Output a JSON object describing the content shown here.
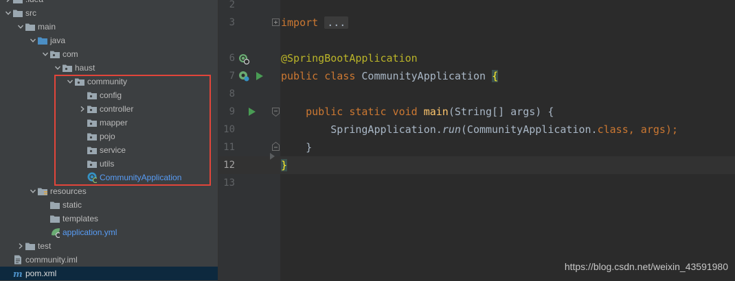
{
  "tree": {
    "items": [
      {
        "label": ".idea",
        "depth": 0,
        "expanded": false,
        "icon": "folder-icon",
        "color": "normal"
      },
      {
        "label": "src",
        "depth": 0,
        "expanded": true,
        "icon": "folder-icon",
        "color": "normal"
      },
      {
        "label": "main",
        "depth": 1,
        "expanded": true,
        "icon": "folder-icon",
        "color": "normal"
      },
      {
        "label": "java",
        "depth": 2,
        "expanded": true,
        "icon": "source-folder-icon",
        "color": "normal"
      },
      {
        "label": "com",
        "depth": 3,
        "expanded": true,
        "icon": "package-icon",
        "color": "normal"
      },
      {
        "label": "haust",
        "depth": 4,
        "expanded": true,
        "icon": "package-icon",
        "color": "normal"
      },
      {
        "label": "community",
        "depth": 5,
        "expanded": true,
        "icon": "package-icon",
        "color": "normal"
      },
      {
        "label": "config",
        "depth": 6,
        "expanded": null,
        "icon": "package-icon",
        "color": "normal"
      },
      {
        "label": "controller",
        "depth": 6,
        "expanded": false,
        "icon": "package-icon",
        "color": "normal"
      },
      {
        "label": "mapper",
        "depth": 6,
        "expanded": null,
        "icon": "package-icon",
        "color": "normal"
      },
      {
        "label": "pojo",
        "depth": 6,
        "expanded": null,
        "icon": "package-icon",
        "color": "normal"
      },
      {
        "label": "service",
        "depth": 6,
        "expanded": null,
        "icon": "package-icon",
        "color": "normal"
      },
      {
        "label": "utils",
        "depth": 6,
        "expanded": null,
        "icon": "package-icon",
        "color": "normal"
      },
      {
        "label": "CommunityApplication",
        "depth": 6,
        "expanded": null,
        "icon": "spring-class-icon",
        "color": "blue"
      },
      {
        "label": "resources",
        "depth": 2,
        "expanded": true,
        "icon": "resources-folder-icon",
        "color": "normal"
      },
      {
        "label": "static",
        "depth": 3,
        "expanded": null,
        "icon": "folder-icon",
        "color": "normal"
      },
      {
        "label": "templates",
        "depth": 3,
        "expanded": null,
        "icon": "folder-icon",
        "color": "normal"
      },
      {
        "label": "application.yml",
        "depth": 3,
        "expanded": null,
        "icon": "spring-yml-icon",
        "color": "blue"
      },
      {
        "label": "test",
        "depth": 1,
        "expanded": false,
        "icon": "folder-icon",
        "color": "normal"
      },
      {
        "label": "community.iml",
        "depth": 0,
        "expanded": null,
        "icon": "iml-file-icon",
        "color": "normal"
      },
      {
        "label": "pom.xml",
        "depth": 0,
        "expanded": null,
        "icon": "maven-icon",
        "color": "white",
        "selected": true
      }
    ]
  },
  "editor": {
    "line_numbers": [
      "2",
      "3",
      "6",
      "7",
      "8",
      "9",
      "10",
      "11",
      "12",
      "13"
    ],
    "current_line": "12",
    "lines": {
      "l3_import": "import",
      "l3_fold": "...",
      "l6_annotation": "@SpringBootApplication",
      "l7_public": "public",
      "l7_class": "class",
      "l7_name": "CommunityApplication",
      "l7_brace": "{",
      "l9_mods": "public static void",
      "l9_method": "main",
      "l9_params": "(String[] args) {",
      "l10_cls": "SpringApplication.",
      "l10_run": "run",
      "l10_args_a": "(CommunityApplication.",
      "l10_kw_class": "class",
      "l10_args_b": ", args);",
      "l11_close": "}",
      "l12_close": "}"
    }
  },
  "watermark": "https://blog.csdn.net/weixin_43591980",
  "colors": {
    "highlight_border": "#e3453a",
    "keyword": "#cc7832",
    "annotation": "#bbb529",
    "method": "#ffc66d",
    "plain": "#a9b7c6",
    "link_blue": "#589df6"
  }
}
